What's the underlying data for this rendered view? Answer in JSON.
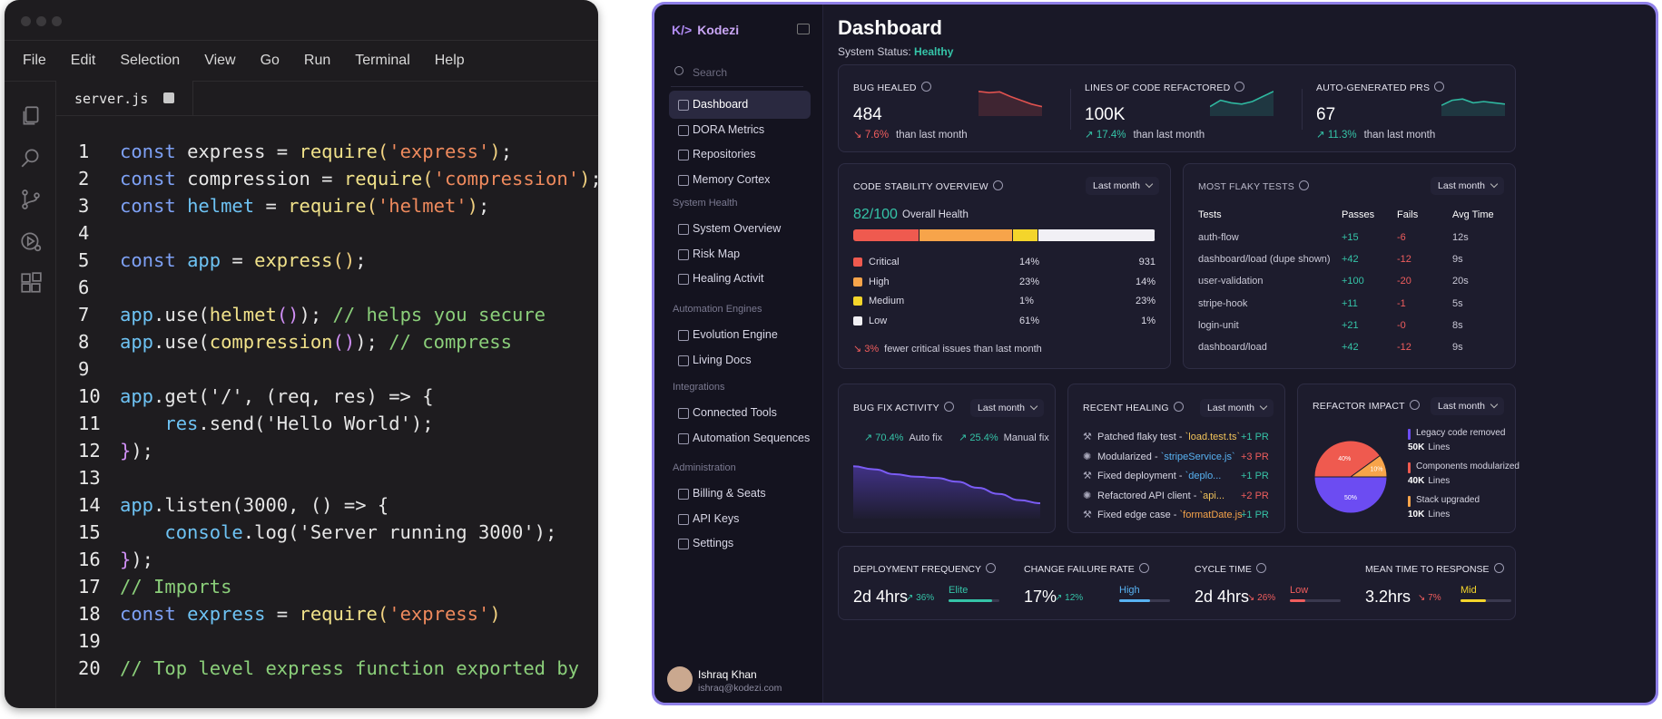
{
  "editor": {
    "menu": [
      "File",
      "Edit",
      "Selection",
      "View",
      "Go",
      "Run",
      "Terminal",
      "Help"
    ],
    "tab": {
      "filename": "server.js"
    },
    "lines": [
      {
        "n": "1",
        "tokens": [
          [
            "const ",
            "kw"
          ],
          [
            "express",
            "pl"
          ],
          [
            " = ",
            "pl"
          ],
          [
            "require",
            "fn"
          ],
          [
            "(",
            "par"
          ],
          [
            "'express'",
            "str"
          ],
          [
            ")",
            "par"
          ],
          [
            ";",
            "pl"
          ]
        ]
      },
      {
        "n": "2",
        "tokens": [
          [
            "const ",
            "kw"
          ],
          [
            "compression",
            "pl"
          ],
          [
            " = ",
            "pl"
          ],
          [
            "require",
            "fn"
          ],
          [
            "(",
            "par"
          ],
          [
            "'compression'",
            "str"
          ],
          [
            ")",
            "par"
          ],
          [
            ";",
            "pl"
          ]
        ]
      },
      {
        "n": "3",
        "tokens": [
          [
            "const ",
            "kw"
          ],
          [
            "helmet",
            "var"
          ],
          [
            " = ",
            "pl"
          ],
          [
            "require",
            "fn"
          ],
          [
            "(",
            "par"
          ],
          [
            "'helmet'",
            "str"
          ],
          [
            ")",
            "par"
          ],
          [
            ";",
            "pl"
          ]
        ]
      },
      {
        "n": "4",
        "tokens": []
      },
      {
        "n": "5",
        "tokens": [
          [
            "const ",
            "kw"
          ],
          [
            "app",
            "var"
          ],
          [
            " = ",
            "pl"
          ],
          [
            "express",
            "fn"
          ],
          [
            "()",
            "par"
          ],
          [
            ";",
            "pl"
          ]
        ]
      },
      {
        "n": "6",
        "tokens": []
      },
      {
        "n": "7",
        "tokens": [
          [
            "app",
            "var"
          ],
          [
            ".use(",
            "pl"
          ],
          [
            "helmet",
            "fn"
          ],
          [
            "()",
            "pu"
          ],
          [
            ");",
            "pl"
          ],
          [
            " // helps you secure",
            "cm"
          ]
        ]
      },
      {
        "n": "8",
        "tokens": [
          [
            "app",
            "var"
          ],
          [
            ".use(",
            "pl"
          ],
          [
            "compression",
            "fn"
          ],
          [
            "()",
            "pu"
          ],
          [
            ");",
            "pl"
          ],
          [
            " // compress",
            "cm"
          ]
        ]
      },
      {
        "n": "9",
        "tokens": []
      },
      {
        "n": "10",
        "tokens": [
          [
            "app",
            "var"
          ],
          [
            ".get('/', (req, res) => {",
            "pl"
          ]
        ]
      },
      {
        "n": "11",
        "tokens": [
          [
            "    res",
            "var"
          ],
          [
            ".send('Hello World');",
            "pl"
          ]
        ]
      },
      {
        "n": "12",
        "tokens": [
          [
            "}",
            "pu"
          ],
          [
            ");",
            "pl"
          ]
        ]
      },
      {
        "n": "13",
        "tokens": []
      },
      {
        "n": "14",
        "tokens": [
          [
            "app",
            "var"
          ],
          [
            ".listen(3000, () => {",
            "pl"
          ]
        ]
      },
      {
        "n": "15",
        "tokens": [
          [
            "    console",
            "var"
          ],
          [
            ".log('Server running 3000');",
            "pl"
          ]
        ]
      },
      {
        "n": "16",
        "tokens": [
          [
            "}",
            "pu"
          ],
          [
            ");",
            "pl"
          ]
        ]
      },
      {
        "n": "17",
        "tokens": [
          [
            "// Imports",
            "cm"
          ]
        ]
      },
      {
        "n": "18",
        "tokens": [
          [
            "const ",
            "kw"
          ],
          [
            "express",
            "var"
          ],
          [
            " = ",
            "pl"
          ],
          [
            "require",
            "fn"
          ],
          [
            "(",
            "par"
          ],
          [
            "'express'",
            "str"
          ],
          [
            ")",
            "par"
          ]
        ]
      },
      {
        "n": "19",
        "tokens": []
      },
      {
        "n": "20",
        "tokens": [
          [
            "// Top level express function exported by",
            "cm"
          ]
        ]
      }
    ]
  },
  "dashboard": {
    "brand": "Kodezi",
    "brand_logo": "K/>",
    "search_placeholder": "Search",
    "nav": {
      "main": [
        "Dashboard",
        "DORA Metrics",
        "Repositories",
        "Memory Cortex"
      ],
      "sections": [
        {
          "title": "System Health",
          "items": [
            "System Overview",
            "Risk Map",
            "Healing Activit"
          ]
        },
        {
          "title": "Automation Engines",
          "items": [
            "Evolution Engine",
            "Living Docs"
          ]
        },
        {
          "title": "Integrations",
          "items": [
            "Connected Tools",
            "Automation Sequences"
          ]
        },
        {
          "title": "Administration",
          "items": [
            "Billing & Seats",
            "API Keys",
            "Settings"
          ]
        }
      ]
    },
    "user": {
      "name": "Ishraq Khan",
      "email": "ishraq@kodezi.com"
    },
    "title": "Dashboard",
    "status_label": "System Status:",
    "status_value": "Healthy",
    "kpis": [
      {
        "label": "BUG HEALED",
        "value": "484",
        "delta": "7.6%",
        "dir": "down",
        "suffix": "than last month",
        "spark_color": "#e0524f",
        "spark": [
          0.9,
          0.85,
          0.88,
          0.7,
          0.55,
          0.4,
          0.3
        ]
      },
      {
        "label": "LINES OF CODE REFACTORED",
        "value": "100K",
        "delta": "17.4%",
        "dir": "up",
        "suffix": "than last month",
        "spark_color": "#2fb8a0",
        "spark": [
          0.3,
          0.55,
          0.45,
          0.4,
          0.5,
          0.7,
          0.9
        ]
      },
      {
        "label": "AUTO-GENERATED PRS",
        "value": "67",
        "delta": "11.3%",
        "dir": "up",
        "suffix": "than last month",
        "spark_color": "#2fb8a0",
        "spark": [
          0.35,
          0.55,
          0.6,
          0.45,
          0.5,
          0.45,
          0.4
        ]
      }
    ],
    "stability": {
      "label": "CODE STABILITY OVERVIEW",
      "range": "Last month",
      "score": "82/100",
      "score_label": "Overall Health",
      "segments": [
        {
          "color": "#ef5a4f",
          "pct": 22
        },
        {
          "color": "#f7a44a",
          "pct": 31
        },
        {
          "color": "#f4d52b",
          "pct": 8
        },
        {
          "color": "#f1f0f5",
          "pct": 39
        }
      ],
      "rows": [
        {
          "name": "Critical",
          "a": "14%",
          "b": "931",
          "color": "#ef5a4f"
        },
        {
          "name": "High",
          "a": "23%",
          "b": "14%",
          "color": "#f7a44a"
        },
        {
          "name": "Medium",
          "a": "1%",
          "b": "23%",
          "color": "#f4d52b"
        },
        {
          "name": "Low",
          "a": "61%",
          "b": "1%",
          "color": "#f1f0f5"
        }
      ],
      "footer_delta": "3%",
      "footer_text": "fewer critical issues than last month"
    },
    "flaky": {
      "label": "MOST FLAKY TESTS",
      "range": "Last month",
      "headers": [
        "Tests",
        "Passes",
        "Fails",
        "Avg Time"
      ],
      "rows": [
        [
          "auth-flow",
          "+15",
          "-6",
          "12s"
        ],
        [
          "dashboard/load (dupe shown)",
          "+42",
          "-12",
          "9s"
        ],
        [
          "user-validation",
          "+100",
          "-20",
          "20s"
        ],
        [
          "stripe-hook",
          "+11",
          "-1",
          "5s"
        ],
        [
          "login-unit",
          "+21",
          "-0",
          "8s"
        ],
        [
          "dashboard/load",
          "+42",
          "-12",
          "9s"
        ]
      ]
    },
    "bugfix": {
      "label": "BUG FIX ACTIVITY",
      "range": "Last month",
      "auto_pct": "70.4%",
      "auto_label": "Auto fix",
      "manual_pct": "25.4%",
      "manual_label": "Manual fix",
      "trend": [
        0.85,
        0.8,
        0.72,
        0.68,
        0.66,
        0.6,
        0.5,
        0.4,
        0.3,
        0.25
      ]
    },
    "healing": {
      "label": "RECENT HEALING",
      "range": "Last month",
      "rows": [
        {
          "icon": "wand-icon",
          "text": "Patched flaky test - ",
          "code": "`load.test.ts`",
          "code_color": "#f1c35a",
          "pr": "+1 PR",
          "pr_color": "#35c4a8"
        },
        {
          "icon": "gear-icon",
          "text": "Modularized - ",
          "code": "`stripeService.js`",
          "code_color": "#58b2f2",
          "pr": "+3 PR",
          "pr_color": "#f05d5d"
        },
        {
          "icon": "wand-icon",
          "text": "Fixed deployment - ",
          "code": "`deplo...",
          "code_color": "#58b2f2",
          "pr": "+1 PR",
          "pr_color": "#35c4a8"
        },
        {
          "icon": "gear-icon",
          "text": "Refactored API client - ",
          "code": "`api...",
          "code_color": "#f1c35a",
          "pr": "+2 PR",
          "pr_color": "#f05d5d"
        },
        {
          "icon": "wand-icon",
          "text": "Fixed edge case - ",
          "code": "`formatDate.js`",
          "code_color": "#f7a44a",
          "pr": "+1 PR",
          "pr_color": "#35c4a8"
        }
      ]
    },
    "refactor": {
      "label": "REFACTOR IMPACT",
      "range": "Last month",
      "slices": [
        {
          "pct": 40,
          "label": "40%",
          "color": "#ef5a4f"
        },
        {
          "pct": 10,
          "label": "10%",
          "color": "#f7a44a"
        },
        {
          "pct": 50,
          "label": "50%",
          "color": "#6c4cf2"
        }
      ],
      "items": [
        {
          "name": "Legacy code removed",
          "value": "50K",
          "unit": "Lines",
          "color": "#6c4cf2"
        },
        {
          "name": "Components modularized",
          "value": "40K",
          "unit": "Lines",
          "color": "#ef5a4f"
        },
        {
          "name": "Stack upgraded",
          "value": "10K",
          "unit": "Lines",
          "color": "#f7a44a"
        }
      ]
    },
    "metrics": [
      {
        "label": "DEPLOYMENT FREQUENCY",
        "value": "2d 4hrs",
        "delta": "36%",
        "dir": "up",
        "tag": "Elite",
        "tag_color": "#35c4a8",
        "fill": 0.85
      },
      {
        "label": "CHANGE FAILURE RATE",
        "value": "17%",
        "delta": "12%",
        "dir": "up",
        "tag": "High",
        "tag_color": "#58b2f2",
        "fill": 0.6
      },
      {
        "label": "CYCLE TIME",
        "value": "2d 4hrs",
        "delta": "26%",
        "dir": "down",
        "tag": "Low",
        "tag_color": "#f05d5d",
        "fill": 0.3
      },
      {
        "label": "MEAN TIME TO RESPONSE",
        "value": "3.2hrs",
        "delta": "7%",
        "dir": "down",
        "tag": "Mid",
        "tag_color": "#f4d52b",
        "fill": 0.5
      }
    ]
  }
}
